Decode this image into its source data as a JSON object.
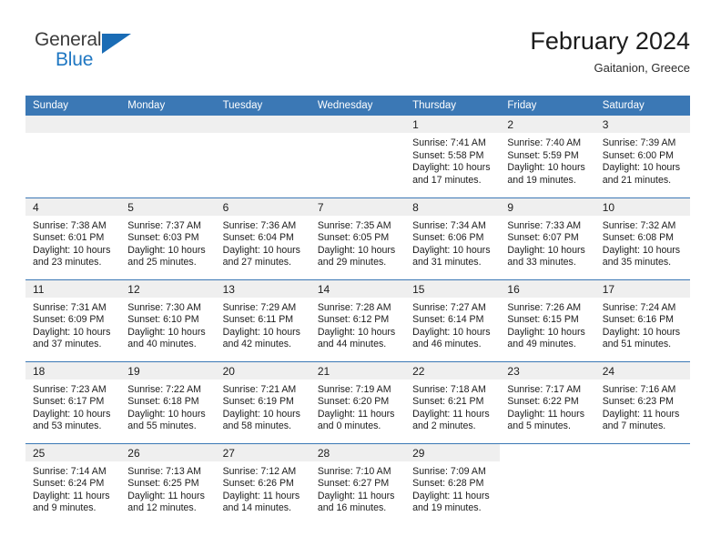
{
  "brand": {
    "word1": "General",
    "word2": "Blue",
    "flag_icon": "flag-triangle-icon"
  },
  "header": {
    "title": "February 2024",
    "subtitle": "Gaitanion, Greece"
  },
  "colors": {
    "header_blue": "#3b78b5",
    "daynum_band": "#efefef",
    "brand_blue": "#1f77c2"
  },
  "calendar": {
    "weekdays": [
      "Sunday",
      "Monday",
      "Tuesday",
      "Wednesday",
      "Thursday",
      "Friday",
      "Saturday"
    ],
    "weeks": [
      [
        {
          "day": "",
          "blank": true
        },
        {
          "day": "",
          "blank": true
        },
        {
          "day": "",
          "blank": true
        },
        {
          "day": "",
          "blank": true
        },
        {
          "day": "1",
          "sunrise": "Sunrise: 7:41 AM",
          "sunset": "Sunset: 5:58 PM",
          "daylight1": "Daylight: 10 hours",
          "daylight2": "and 17 minutes."
        },
        {
          "day": "2",
          "sunrise": "Sunrise: 7:40 AM",
          "sunset": "Sunset: 5:59 PM",
          "daylight1": "Daylight: 10 hours",
          "daylight2": "and 19 minutes."
        },
        {
          "day": "3",
          "sunrise": "Sunrise: 7:39 AM",
          "sunset": "Sunset: 6:00 PM",
          "daylight1": "Daylight: 10 hours",
          "daylight2": "and 21 minutes."
        }
      ],
      [
        {
          "day": "4",
          "sunrise": "Sunrise: 7:38 AM",
          "sunset": "Sunset: 6:01 PM",
          "daylight1": "Daylight: 10 hours",
          "daylight2": "and 23 minutes."
        },
        {
          "day": "5",
          "sunrise": "Sunrise: 7:37 AM",
          "sunset": "Sunset: 6:03 PM",
          "daylight1": "Daylight: 10 hours",
          "daylight2": "and 25 minutes."
        },
        {
          "day": "6",
          "sunrise": "Sunrise: 7:36 AM",
          "sunset": "Sunset: 6:04 PM",
          "daylight1": "Daylight: 10 hours",
          "daylight2": "and 27 minutes."
        },
        {
          "day": "7",
          "sunrise": "Sunrise: 7:35 AM",
          "sunset": "Sunset: 6:05 PM",
          "daylight1": "Daylight: 10 hours",
          "daylight2": "and 29 minutes."
        },
        {
          "day": "8",
          "sunrise": "Sunrise: 7:34 AM",
          "sunset": "Sunset: 6:06 PM",
          "daylight1": "Daylight: 10 hours",
          "daylight2": "and 31 minutes."
        },
        {
          "day": "9",
          "sunrise": "Sunrise: 7:33 AM",
          "sunset": "Sunset: 6:07 PM",
          "daylight1": "Daylight: 10 hours",
          "daylight2": "and 33 minutes."
        },
        {
          "day": "10",
          "sunrise": "Sunrise: 7:32 AM",
          "sunset": "Sunset: 6:08 PM",
          "daylight1": "Daylight: 10 hours",
          "daylight2": "and 35 minutes."
        }
      ],
      [
        {
          "day": "11",
          "sunrise": "Sunrise: 7:31 AM",
          "sunset": "Sunset: 6:09 PM",
          "daylight1": "Daylight: 10 hours",
          "daylight2": "and 37 minutes."
        },
        {
          "day": "12",
          "sunrise": "Sunrise: 7:30 AM",
          "sunset": "Sunset: 6:10 PM",
          "daylight1": "Daylight: 10 hours",
          "daylight2": "and 40 minutes."
        },
        {
          "day": "13",
          "sunrise": "Sunrise: 7:29 AM",
          "sunset": "Sunset: 6:11 PM",
          "daylight1": "Daylight: 10 hours",
          "daylight2": "and 42 minutes."
        },
        {
          "day": "14",
          "sunrise": "Sunrise: 7:28 AM",
          "sunset": "Sunset: 6:12 PM",
          "daylight1": "Daylight: 10 hours",
          "daylight2": "and 44 minutes."
        },
        {
          "day": "15",
          "sunrise": "Sunrise: 7:27 AM",
          "sunset": "Sunset: 6:14 PM",
          "daylight1": "Daylight: 10 hours",
          "daylight2": "and 46 minutes."
        },
        {
          "day": "16",
          "sunrise": "Sunrise: 7:26 AM",
          "sunset": "Sunset: 6:15 PM",
          "daylight1": "Daylight: 10 hours",
          "daylight2": "and 49 minutes."
        },
        {
          "day": "17",
          "sunrise": "Sunrise: 7:24 AM",
          "sunset": "Sunset: 6:16 PM",
          "daylight1": "Daylight: 10 hours",
          "daylight2": "and 51 minutes."
        }
      ],
      [
        {
          "day": "18",
          "sunrise": "Sunrise: 7:23 AM",
          "sunset": "Sunset: 6:17 PM",
          "daylight1": "Daylight: 10 hours",
          "daylight2": "and 53 minutes."
        },
        {
          "day": "19",
          "sunrise": "Sunrise: 7:22 AM",
          "sunset": "Sunset: 6:18 PM",
          "daylight1": "Daylight: 10 hours",
          "daylight2": "and 55 minutes."
        },
        {
          "day": "20",
          "sunrise": "Sunrise: 7:21 AM",
          "sunset": "Sunset: 6:19 PM",
          "daylight1": "Daylight: 10 hours",
          "daylight2": "and 58 minutes."
        },
        {
          "day": "21",
          "sunrise": "Sunrise: 7:19 AM",
          "sunset": "Sunset: 6:20 PM",
          "daylight1": "Daylight: 11 hours",
          "daylight2": "and 0 minutes."
        },
        {
          "day": "22",
          "sunrise": "Sunrise: 7:18 AM",
          "sunset": "Sunset: 6:21 PM",
          "daylight1": "Daylight: 11 hours",
          "daylight2": "and 2 minutes."
        },
        {
          "day": "23",
          "sunrise": "Sunrise: 7:17 AM",
          "sunset": "Sunset: 6:22 PM",
          "daylight1": "Daylight: 11 hours",
          "daylight2": "and 5 minutes."
        },
        {
          "day": "24",
          "sunrise": "Sunrise: 7:16 AM",
          "sunset": "Sunset: 6:23 PM",
          "daylight1": "Daylight: 11 hours",
          "daylight2": "and 7 minutes."
        }
      ],
      [
        {
          "day": "25",
          "sunrise": "Sunrise: 7:14 AM",
          "sunset": "Sunset: 6:24 PM",
          "daylight1": "Daylight: 11 hours",
          "daylight2": "and 9 minutes."
        },
        {
          "day": "26",
          "sunrise": "Sunrise: 7:13 AM",
          "sunset": "Sunset: 6:25 PM",
          "daylight1": "Daylight: 11 hours",
          "daylight2": "and 12 minutes."
        },
        {
          "day": "27",
          "sunrise": "Sunrise: 7:12 AM",
          "sunset": "Sunset: 6:26 PM",
          "daylight1": "Daylight: 11 hours",
          "daylight2": "and 14 minutes."
        },
        {
          "day": "28",
          "sunrise": "Sunrise: 7:10 AM",
          "sunset": "Sunset: 6:27 PM",
          "daylight1": "Daylight: 11 hours",
          "daylight2": "and 16 minutes."
        },
        {
          "day": "29",
          "sunrise": "Sunrise: 7:09 AM",
          "sunset": "Sunset: 6:28 PM",
          "daylight1": "Daylight: 11 hours",
          "daylight2": "and 19 minutes."
        },
        {
          "day": "",
          "nobg": true
        },
        {
          "day": "",
          "nobg": true
        }
      ]
    ]
  }
}
